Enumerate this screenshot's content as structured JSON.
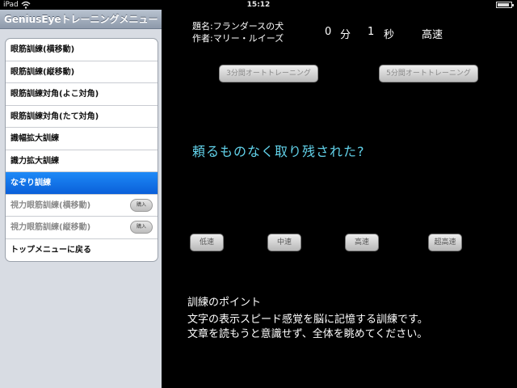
{
  "status_bar": {
    "carrier": "iPad",
    "time": "15:12"
  },
  "sidebar": {
    "title": "GeniusEyeトレーニングメニュー",
    "items": [
      {
        "label": "眼筋訓練(横移動)",
        "state": "normal"
      },
      {
        "label": "眼筋訓練(縦移動)",
        "state": "normal"
      },
      {
        "label": "眼筋訓練対角(よこ対角)",
        "state": "normal"
      },
      {
        "label": "眼筋訓練対角(たて対角)",
        "state": "normal"
      },
      {
        "label": "識幅拡大訓練",
        "state": "normal"
      },
      {
        "label": "識力拡大訓練",
        "state": "normal"
      },
      {
        "label": "なぞり訓練",
        "state": "selected"
      },
      {
        "label": "視力眼筋訓練(横移動)",
        "state": "disabled",
        "buy_label": "購入"
      },
      {
        "label": "視力眼筋訓練(縦移動)",
        "state": "disabled",
        "buy_label": "購入"
      },
      {
        "label": "トップメニューに戻る",
        "state": "normal"
      }
    ]
  },
  "main": {
    "title_line": "題名:フランダースの犬",
    "author_line": "作者:マリー・ルイーズ",
    "timer": {
      "minutes": "0",
      "min_unit": "分",
      "seconds": "1",
      "sec_unit": "秒",
      "speed": "高速"
    },
    "auto_buttons": {
      "three_min": "3分間オートトレーニング",
      "five_min": "5分間オートトレーニング"
    },
    "reading_text": "頼るものなく取り残された?",
    "speed_buttons": {
      "low": "低速",
      "mid": "中速",
      "high": "高速",
      "ultra": "超高速"
    },
    "training_point": {
      "heading": "訓練のポイント",
      "line1": "文字の表示スピード感覚を脳に記憶する訓練です。",
      "line2": "文章を読もうと意識せず、全体を眺めてください。"
    }
  },
  "colors": {
    "selected": "#0a5fd9",
    "reading_text": "#62d2ea",
    "background": "#000000"
  }
}
